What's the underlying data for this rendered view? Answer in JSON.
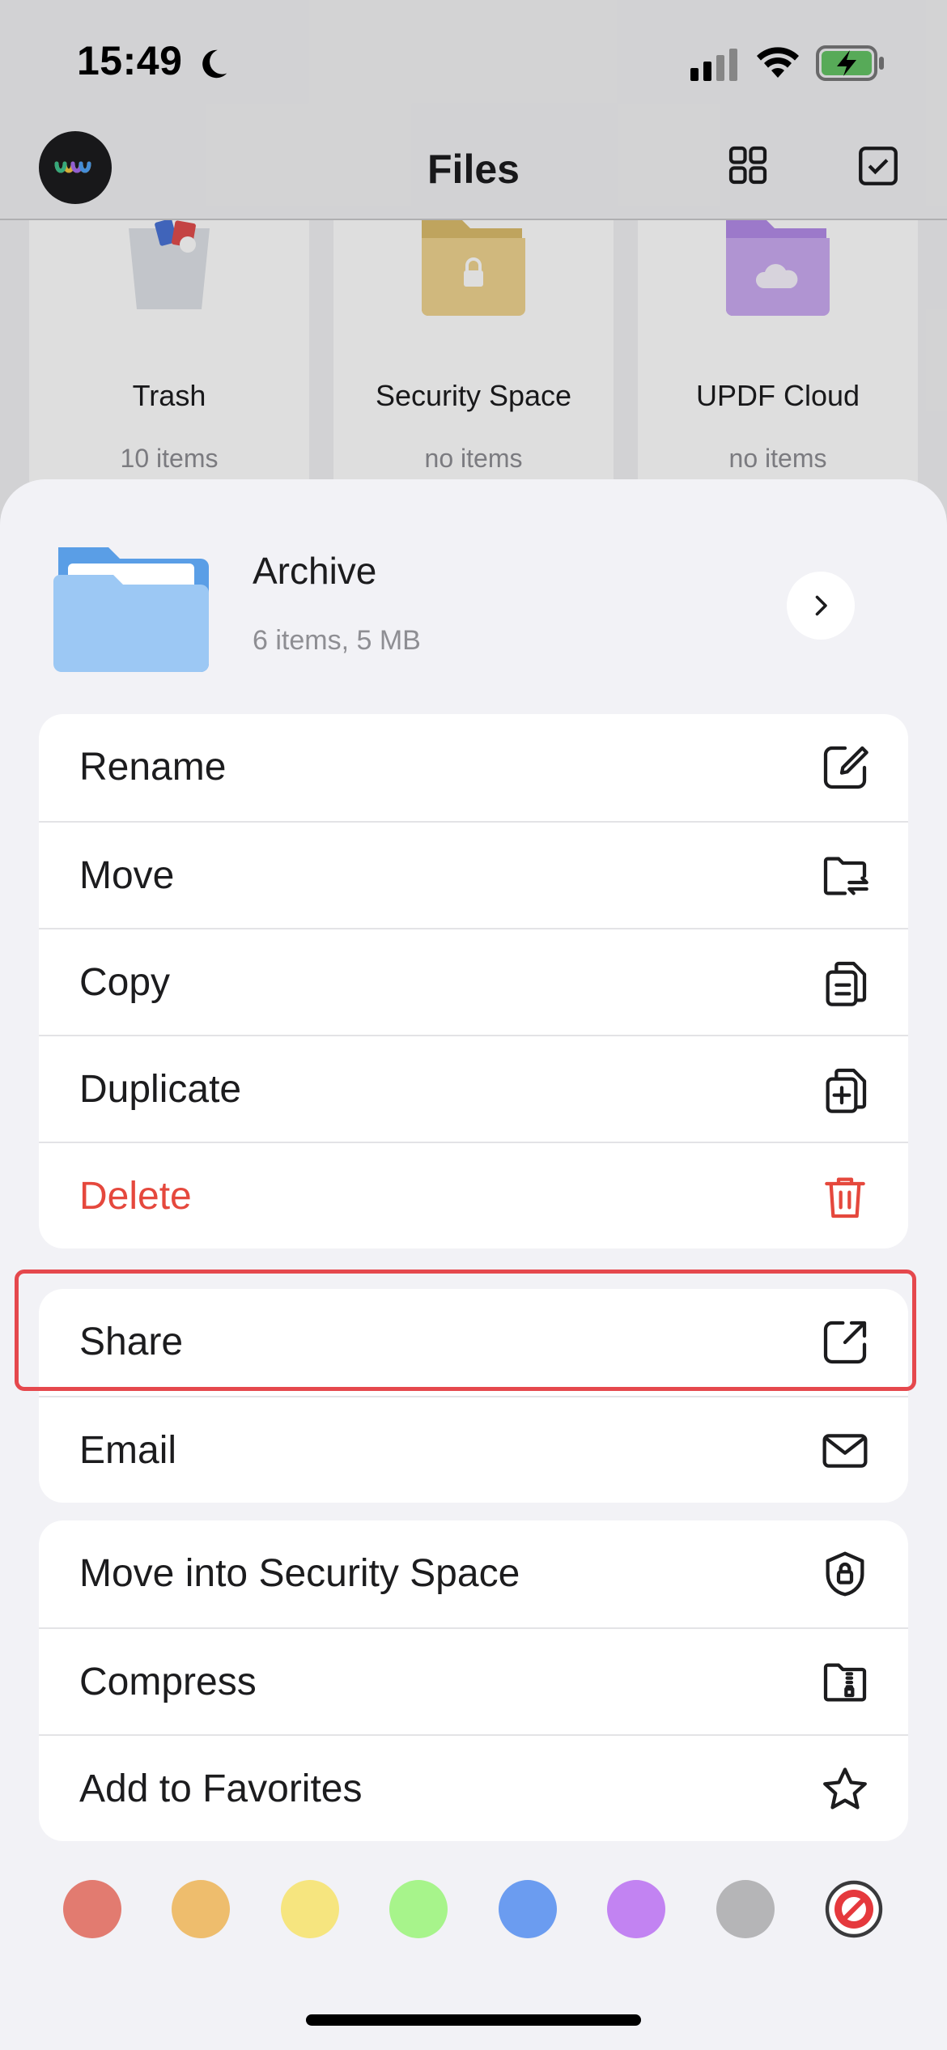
{
  "status_bar": {
    "time": "15:49"
  },
  "nav": {
    "title": "Files"
  },
  "folders": [
    {
      "name": "Trash",
      "meta": "10 items"
    },
    {
      "name": "Security Space",
      "meta": "no items"
    },
    {
      "name": "UPDF Cloud",
      "meta": "no items"
    }
  ],
  "sheet": {
    "item_name": "Archive",
    "item_meta": "6 items, 5 MB",
    "groups": [
      [
        {
          "label": "Rename",
          "icon": "rename-icon"
        },
        {
          "label": "Move",
          "icon": "move-folder-icon"
        },
        {
          "label": "Copy",
          "icon": "copy-icon"
        },
        {
          "label": "Duplicate",
          "icon": "duplicate-icon"
        },
        {
          "label": "Delete",
          "icon": "trash-icon",
          "danger": true
        }
      ],
      [
        {
          "label": "Share",
          "icon": "share-icon",
          "highlighted": true
        },
        {
          "label": "Email",
          "icon": "envelope-icon"
        }
      ],
      [
        {
          "label": "Move into Security Space",
          "icon": "shield-lock-icon"
        },
        {
          "label": "Compress",
          "icon": "zip-folder-icon"
        },
        {
          "label": "Add to Favorites",
          "icon": "star-icon"
        }
      ]
    ],
    "color_tags": [
      "#e27b70",
      "#eebd6d",
      "#f6e57f",
      "#a7f48b",
      "#6b9cf0",
      "#c283f2",
      "#b5b5b7"
    ],
    "highlight_color": "#e5484d"
  }
}
